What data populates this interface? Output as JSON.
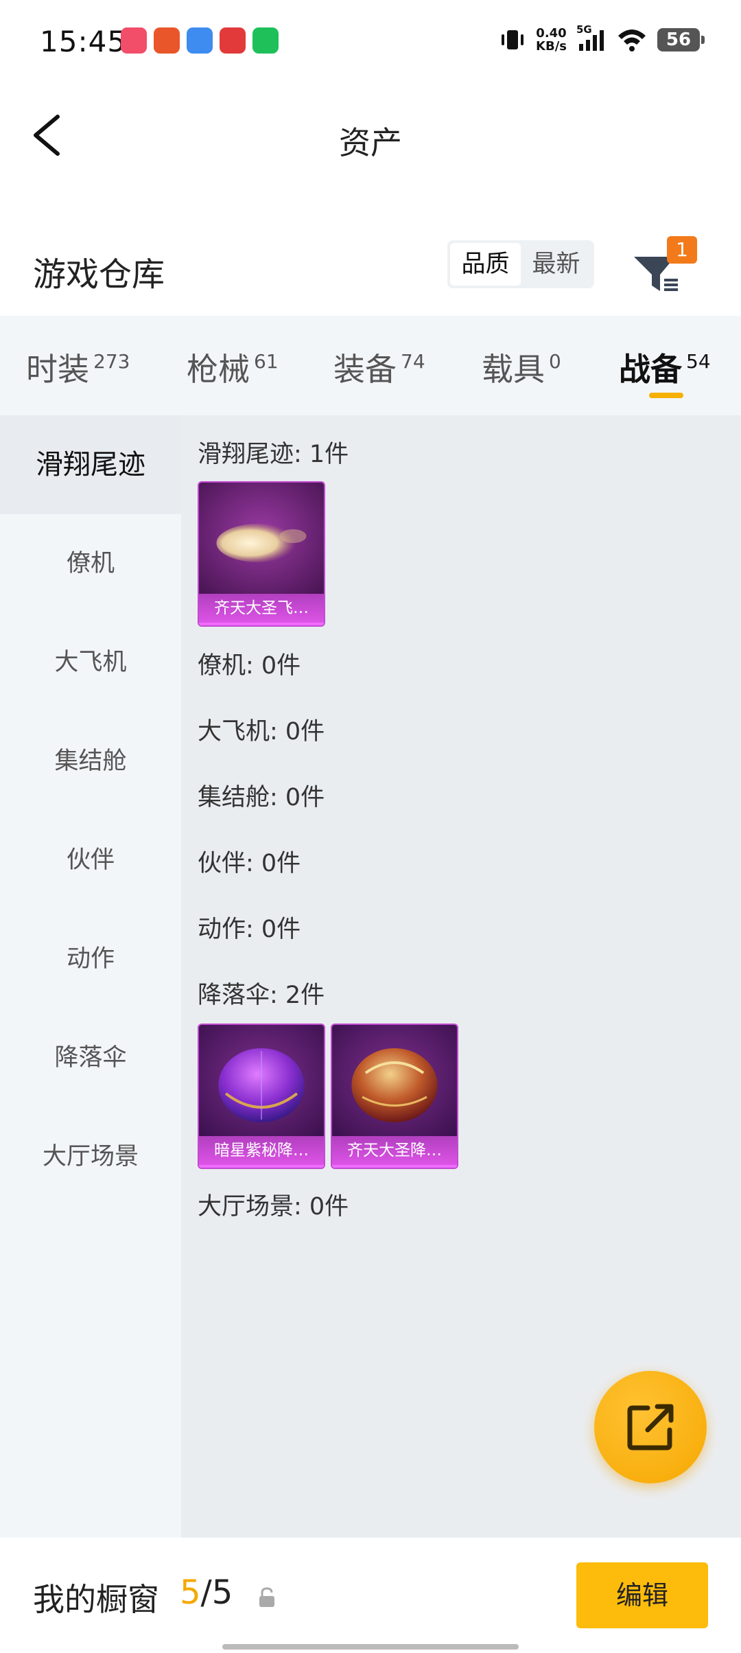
{
  "status_bar": {
    "time": "15:45",
    "net_speed_value": "0.40",
    "net_speed_unit": "KB/s",
    "network": "5G",
    "battery": "56",
    "app_colors": [
      "#f24e6a",
      "#e8562a",
      "#3f8cf0",
      "#e23a3a",
      "#1fc05a"
    ]
  },
  "nav": {
    "title": "资产",
    "back_icon": "chevron-left-icon"
  },
  "warehouse": {
    "title": "游戏仓库",
    "sort_options": [
      "品质",
      "最新"
    ],
    "sort_active": "品质",
    "filter_badge": "1"
  },
  "category_tabs": [
    {
      "label": "时装",
      "count": "273"
    },
    {
      "label": "枪械",
      "count": "61"
    },
    {
      "label": "装备",
      "count": "74"
    },
    {
      "label": "载具",
      "count": "0"
    },
    {
      "label": "战备",
      "count": "54",
      "active": true
    }
  ],
  "sub_nav": [
    {
      "label": "滑翔尾迹",
      "active": true
    },
    {
      "label": "僚机"
    },
    {
      "label": "大飞机"
    },
    {
      "label": "集结舱"
    },
    {
      "label": "伙伴"
    },
    {
      "label": "动作"
    },
    {
      "label": "降落伞"
    },
    {
      "label": "大厅场景"
    }
  ],
  "sections": [
    {
      "label": "滑翔尾迹: 1件",
      "items": [
        {
          "name": "齐天大圣飞…",
          "art": "glide-trail"
        }
      ]
    },
    {
      "label": "僚机: 0件",
      "items": []
    },
    {
      "label": "大飞机: 0件",
      "items": []
    },
    {
      "label": "集结舱: 0件",
      "items": []
    },
    {
      "label": "伙伴: 0件",
      "items": []
    },
    {
      "label": "动作: 0件",
      "items": []
    },
    {
      "label": "降落伞: 2件",
      "items": [
        {
          "name": "暗星紫秘降…",
          "art": "parachute-purple"
        },
        {
          "name": "齐天大圣降…",
          "art": "parachute-gold"
        }
      ]
    },
    {
      "label": "大厅场景: 0件",
      "items": []
    }
  ],
  "colors": {
    "accent": "#f5b000",
    "card_purple": "#c24bd1",
    "badge": "#f27a1a"
  },
  "showcase": {
    "label": "我的橱窗",
    "current": "5",
    "separator": "/",
    "total": "5",
    "edit_label": "编辑"
  }
}
